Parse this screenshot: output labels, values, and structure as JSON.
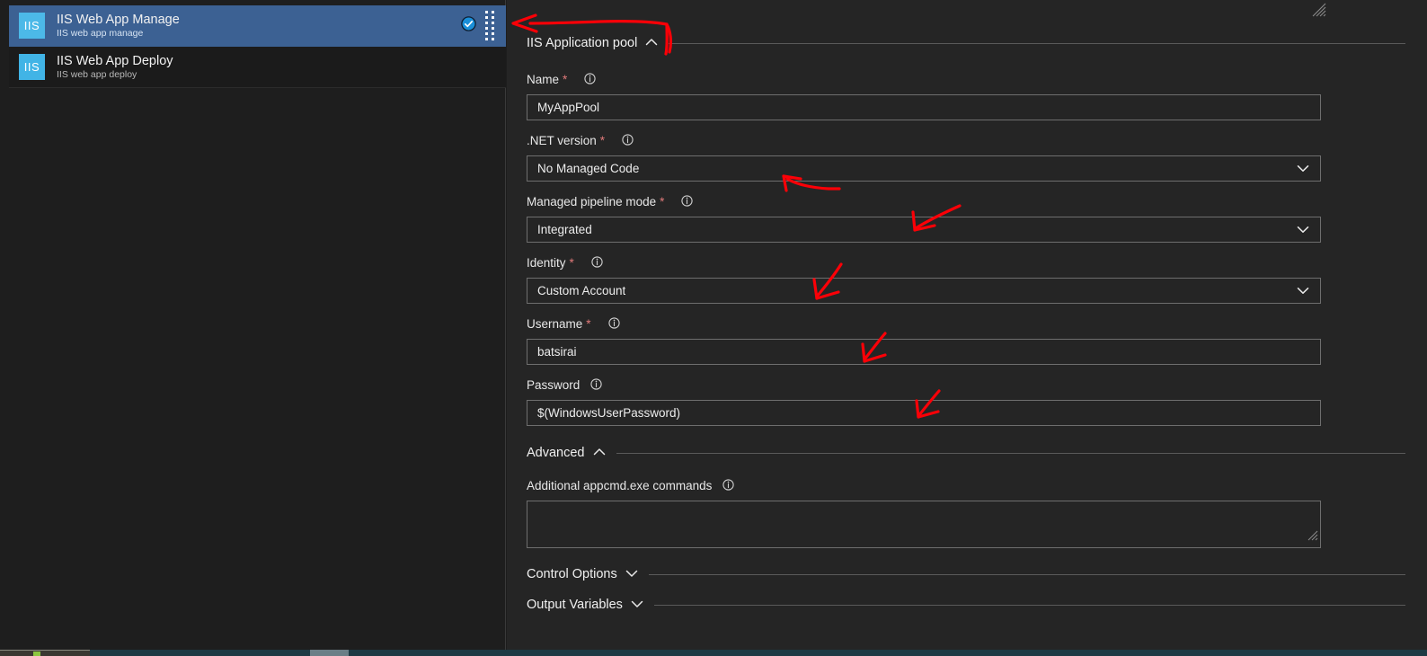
{
  "task_list": {
    "items": [
      {
        "icon": "iis-tile-icon",
        "tile_text": "IIS",
        "title": "IIS Web App Manage",
        "subtitle": "IIS web app manage",
        "selected": true,
        "has_check": true,
        "has_grip": true
      },
      {
        "icon": "iis-tile-icon",
        "tile_text": "IIS",
        "title": "IIS Web App Deploy",
        "subtitle": "IIS web app deploy",
        "selected": false,
        "has_check": false,
        "has_grip": false
      }
    ]
  },
  "panel": {
    "sections": {
      "app_pool": {
        "label": "IIS Application pool",
        "state": "expanded"
      },
      "advanced": {
        "label": "Advanced",
        "state": "expanded"
      },
      "control_options": {
        "label": "Control Options",
        "state": "collapsed"
      },
      "output_variables": {
        "label": "Output Variables",
        "state": "collapsed"
      }
    },
    "fields": {
      "name": {
        "label": "Name",
        "required": true,
        "value": "MyAppPool",
        "type": "text"
      },
      "net_version": {
        "label": ".NET version",
        "required": true,
        "value": "No Managed Code",
        "type": "select"
      },
      "pipeline_mode": {
        "label": "Managed pipeline mode",
        "required": true,
        "value": "Integrated",
        "type": "select"
      },
      "identity": {
        "label": "Identity",
        "required": true,
        "value": "Custom Account",
        "type": "select"
      },
      "username": {
        "label": "Username",
        "required": true,
        "value": "batsirai",
        "type": "text"
      },
      "password": {
        "label": "Password",
        "required": false,
        "value": "$(WindowsUserPassword)",
        "type": "text"
      },
      "appcmd": {
        "label": "Additional appcmd.exe commands",
        "required": false,
        "value": "",
        "type": "textarea"
      }
    },
    "required_marker": "*"
  },
  "colors": {
    "selection_blue": "#3c6193",
    "iis_tile_blue": "#41b4e6",
    "panel_background": "#252525",
    "annotation_red": "#fb0007",
    "required_star": "#e07a7a",
    "field_border": "#6e6e6e"
  },
  "annotations": {
    "ink_color": "#fb0007",
    "marks": [
      {
        "name": "arrow-to-iis-application-pool",
        "target": "IIS Application pool"
      },
      {
        "name": "arrow-to-net-version",
        "target": "No Managed Code"
      },
      {
        "name": "arrow-to-managed-pipeline-mode",
        "target": "Integrated"
      },
      {
        "name": "arrow-to-identity",
        "target": "Custom Account"
      },
      {
        "name": "arrow-to-username",
        "target": "batsirai"
      },
      {
        "name": "arrow-to-password",
        "target": "$(WindowsUserPassword)"
      }
    ]
  }
}
